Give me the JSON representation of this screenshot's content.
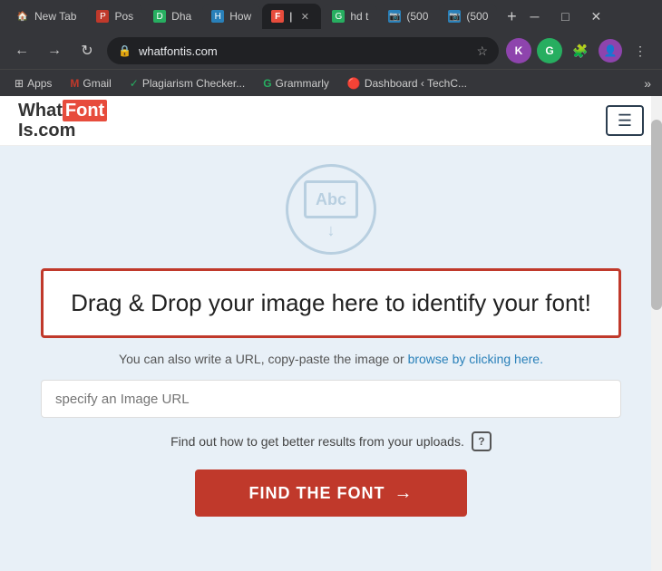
{
  "browser": {
    "tabs": [
      {
        "id": "new-tab",
        "label": "New Tab",
        "favicon": "🏠",
        "active": false
      },
      {
        "id": "post",
        "label": "Pos",
        "favicon": "🔴",
        "active": false
      },
      {
        "id": "dha",
        "label": "Dha",
        "favicon": "🟢",
        "active": false
      },
      {
        "id": "how",
        "label": "How",
        "favicon": "🖥️",
        "active": false
      },
      {
        "id": "whatfont",
        "label": "F",
        "favicon": "🔴",
        "active": true
      },
      {
        "id": "hdt",
        "label": "hd t",
        "favicon": "🟢",
        "active": false
      },
      {
        "id": "500a",
        "label": "(500",
        "favicon": "🖥️",
        "active": false
      },
      {
        "id": "500b",
        "label": "(500",
        "favicon": "🖥️",
        "active": false
      }
    ],
    "url": "whatfontis.com",
    "bookmarks": [
      {
        "label": "Apps",
        "icon": "⊞"
      },
      {
        "label": "Gmail",
        "icon": "M"
      },
      {
        "label": "Plagiarism Checker...",
        "icon": "✓"
      },
      {
        "label": "Grammarly",
        "icon": "G"
      },
      {
        "label": "Dashboard ‹ TechC...",
        "icon": "🔴"
      }
    ]
  },
  "site": {
    "logo_part1": "What",
    "logo_font": "Font",
    "logo_part2": "Is.com",
    "menu_icon": "☰",
    "illustration_text": "Abc",
    "drag_drop_text": "Drag & Drop your image here to identify your font!",
    "subtitle_text": "You can also write a URL, copy-paste the image or",
    "subtitle_link": "browse by clicking here.",
    "url_placeholder": "specify an Image URL",
    "better_results_text": "Find out how to get better results from your uploads.",
    "question_mark": "?",
    "find_font_label": "FIND THE FONT"
  }
}
